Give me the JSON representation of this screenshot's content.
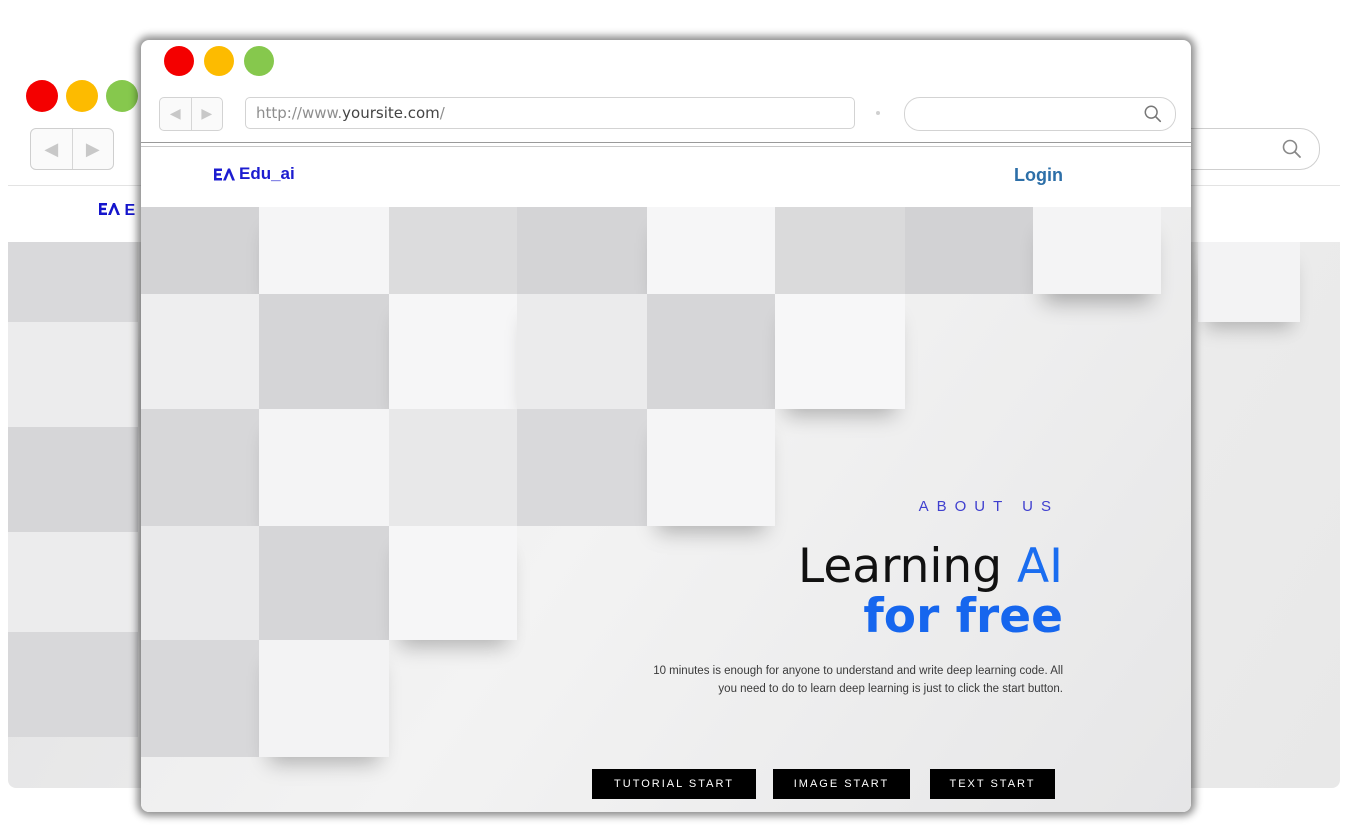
{
  "front_browser": {
    "url_prefix": "http://www.",
    "url_domain": "yoursite.com",
    "url_suffix": "/",
    "back_arrow": "◀",
    "forward_arrow": "▶"
  },
  "site": {
    "logo_text": "Edu_ai",
    "login_label": "Login"
  },
  "hero": {
    "eyebrow": "ABOUT US",
    "headline_part1": "Learning ",
    "headline_highlight": "AI",
    "headline_line2": "for free",
    "description": "10 minutes is enough for anyone to understand and write deep learning code. All you need to do to learn deep learning is just to click the start button."
  },
  "buttons": [
    {
      "label": "TUTORIAL START"
    },
    {
      "label": "IMAGE START"
    },
    {
      "label": "TEXT START"
    }
  ],
  "back_browser": {
    "logo_text": "E",
    "back_arrow": "◀",
    "forward_arrow": "▶"
  },
  "colors": {
    "accent_blue": "#1666ee",
    "logo_blue": "#1d1dd0",
    "login_blue": "#2d6fa8",
    "traffic_red": "#f40000",
    "traffic_yellow": "#fdbb00",
    "traffic_green": "#86c84d"
  },
  "icons": [
    "search-icon",
    "back-arrow-icon",
    "forward-arrow-icon",
    "logo-icon"
  ]
}
